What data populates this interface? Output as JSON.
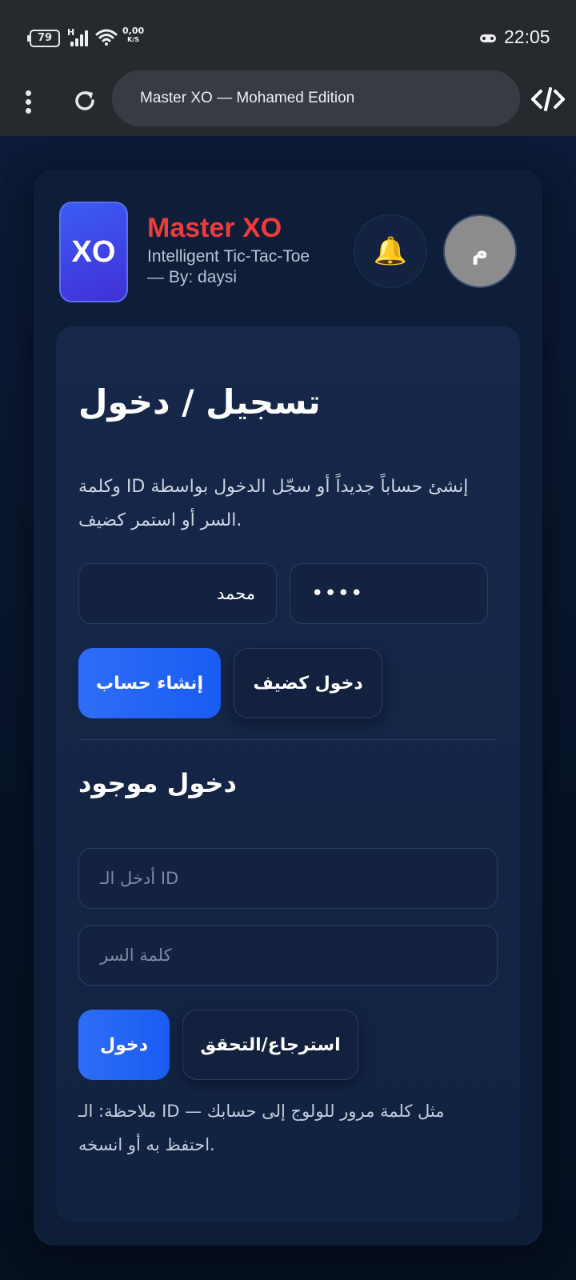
{
  "status_bar": {
    "battery": "79",
    "network_type": "H",
    "net_speed": "0,00",
    "net_speed_unit": "K/S",
    "time": "22:05"
  },
  "browser": {
    "url_text": "Master XO — Mohamed Edition"
  },
  "header": {
    "logo_text": "XO",
    "title": "Master XO",
    "subtitle": "Intelligent Tic-Tac-Toe — By: daysi",
    "bell_icon": "🔔",
    "avatar_initial": "م"
  },
  "register": {
    "heading": "تسجيل / دخول",
    "description": "وكلمة ID إنشئ حساباً جديداً أو سجّل الدخول بواسطة السر أو استمر كضيف.",
    "name_value": "محمد",
    "password_value": "••••",
    "create_button": "إنشاء حساب",
    "guest_button": "دخول كضيف"
  },
  "login": {
    "heading": "دخول موجود",
    "id_placeholder": "أدخل الـ ID",
    "password_placeholder": "كلمة السر",
    "login_button": "دخول",
    "recover_button": "استرجاع/التحقق",
    "note": "ملاحظة: الـ ID — مثل كلمة مرور للولوج إلى حسابك احتفظ به أو انسخه."
  },
  "colors": {
    "title_red": "#f03b3b",
    "primary_blue": "#2f6df7",
    "background": "#06142a"
  }
}
